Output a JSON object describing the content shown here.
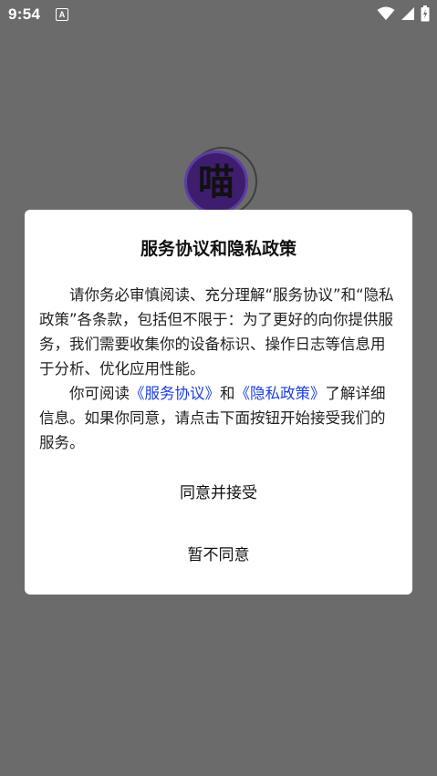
{
  "status_bar": {
    "time": "9:54",
    "notification_icon": "A",
    "icons": [
      "wifi-icon",
      "signal-icon",
      "battery-icon"
    ]
  },
  "splash": {
    "logo_char": "喵",
    "logo_color": "#3e1d6e"
  },
  "dialog": {
    "title": "服务协议和隐私政策",
    "paragraph1": "请你务必审慎阅读、充分理解“服务协议”和“隐私政策”各条款，包括但不限于：为了更好的向你提供服务，我们需要收集你的设备标识、操作日志等信息用于分析、优化应用性能。",
    "paragraph2_prefix": "你可阅读",
    "link_service": "《服务协议》",
    "paragraph2_and": "和",
    "link_privacy": "《隐私政策》",
    "paragraph2_suffix": "了解详细信息。如果你同意，请点击下面按钮开始接受我们的服务。",
    "agree_button": "同意并接受",
    "disagree_button": "暂不同意"
  },
  "colors": {
    "overlay": "#6b6b6b",
    "link": "#1a3fe0",
    "dialog_bg": "#ffffff"
  }
}
